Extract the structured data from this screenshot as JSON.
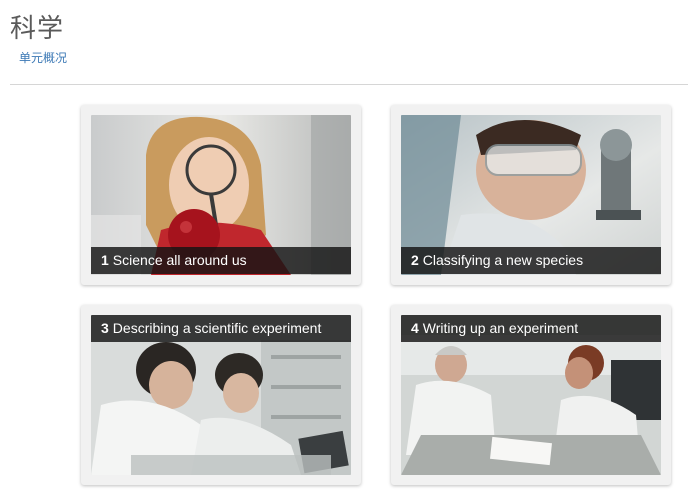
{
  "header": {
    "title": "科学",
    "overview_link": "单元概况"
  },
  "units": [
    {
      "number": "1",
      "title": "Science all around us"
    },
    {
      "number": "2",
      "title": "Classifying a new species"
    },
    {
      "number": "3",
      "title": "Describing a scientific experiment"
    },
    {
      "number": "4",
      "title": "Writing up an experiment"
    }
  ]
}
